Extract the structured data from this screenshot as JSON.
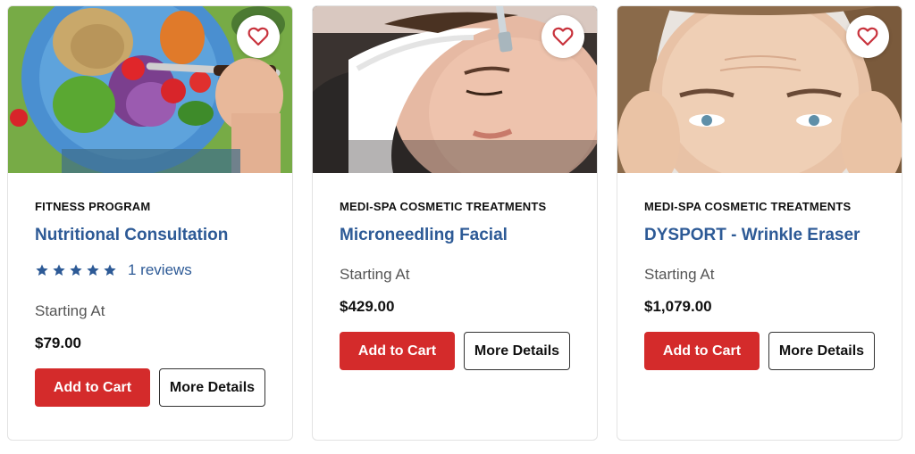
{
  "colors": {
    "accent_blue": "#2d5a96",
    "cart_red": "#d42b2b",
    "heart_red": "#c8323c"
  },
  "products": [
    {
      "category": "FITNESS PROGRAM",
      "title": "Nutritional Consultation",
      "rating": 5,
      "reviews": "1 reviews",
      "starting_label": "Starting At",
      "price": "$79.00",
      "add_to_cart": "Add to Cart",
      "more_details": "More Details",
      "icon": "heart-icon"
    },
    {
      "category": "MEDI-SPA COSMETIC TREATMENTS",
      "title": "Microneedling Facial",
      "starting_label": "Starting At",
      "price": "$429.00",
      "add_to_cart": "Add to Cart",
      "more_details": "More Details",
      "icon": "heart-icon"
    },
    {
      "category": "MEDI-SPA COSMETIC TREATMENTS",
      "title": "DYSPORT - Wrinkle Eraser",
      "starting_label": "Starting At",
      "price": "$1,079.00",
      "add_to_cart": "Add to Cart",
      "more_details": "More Details",
      "icon": "heart-icon"
    }
  ]
}
